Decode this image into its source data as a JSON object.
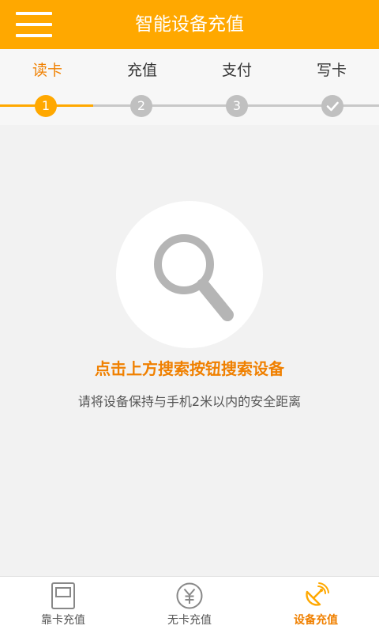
{
  "header": {
    "title": "智能设备充值",
    "menu_icon": "menu-icon",
    "bg_color": "#ffa800"
  },
  "steps": [
    {
      "label": "读卡",
      "marker": "1",
      "active": true
    },
    {
      "label": "充值",
      "marker": "2",
      "active": false
    },
    {
      "label": "支付",
      "marker": "3",
      "active": false
    },
    {
      "label": "写卡",
      "marker": "check-icon",
      "active": false
    }
  ],
  "main": {
    "search_icon": "search-icon",
    "hint": "点击上方搜索按钮搜索设备",
    "subhint": "请将设备保持与手机2米以内的安全距离"
  },
  "bottom_nav": [
    {
      "label": "靠卡充值",
      "icon": "card-icon",
      "active": false
    },
    {
      "label": "无卡充值",
      "icon": "yen-icon",
      "active": false
    },
    {
      "label": "设备充值",
      "icon": "satellite-icon",
      "active": true
    }
  ],
  "colors": {
    "accent": "#ffa800",
    "accent_text": "#f08000",
    "inactive": "#c0c0c0"
  }
}
